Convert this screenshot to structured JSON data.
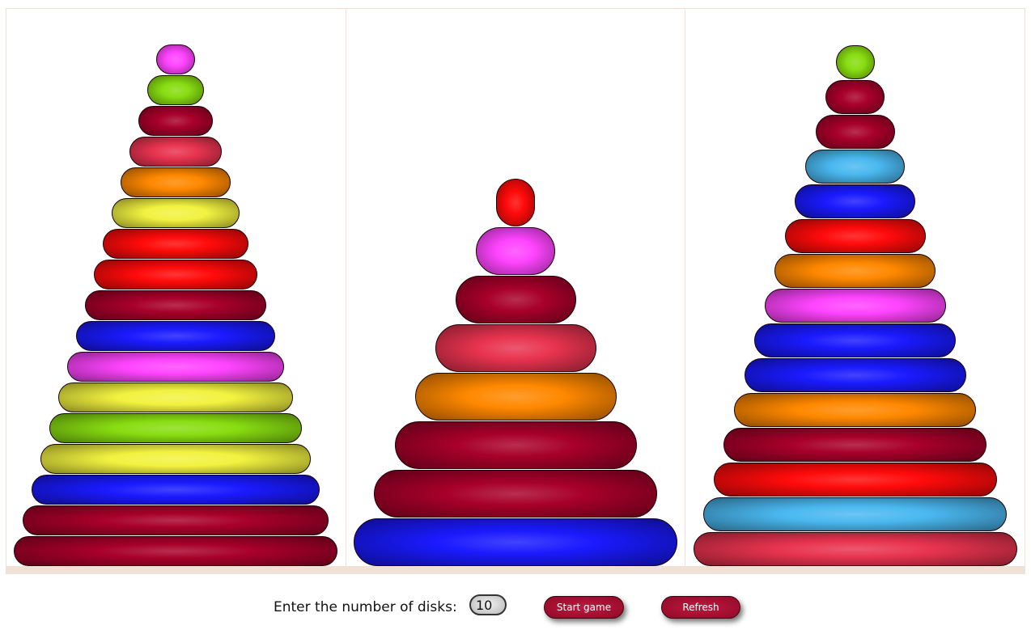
{
  "colors": {
    "magenta": "#ff44ff",
    "green": "#88dd11",
    "maroon": "#a8002a",
    "crimson": "#e8334f",
    "orange": "#ff8800",
    "yellow": "#f2f240",
    "red": "#ff0a0a",
    "blue": "#1a1aff",
    "cyan": "#4ab8f0"
  },
  "towers": [
    {
      "name": "left",
      "disks": [
        "magenta",
        "green",
        "maroon",
        "crimson",
        "orange",
        "yellow",
        "red",
        "red",
        "maroon",
        "blue",
        "magenta",
        "yellow",
        "green",
        "yellow",
        "blue",
        "maroon",
        "maroon"
      ]
    },
    {
      "name": "middle",
      "disks": [
        "red",
        "magenta",
        "maroon",
        "crimson",
        "orange",
        "maroon",
        "maroon",
        "blue"
      ]
    },
    {
      "name": "right",
      "disks": [
        "green",
        "maroon",
        "maroon",
        "cyan",
        "blue",
        "red",
        "orange",
        "magenta",
        "blue",
        "blue",
        "orange",
        "maroon",
        "red",
        "cyan",
        "crimson"
      ]
    }
  ],
  "controls": {
    "label": "Enter the number of disks:",
    "disks_value": "10",
    "start_label": "Start game",
    "refresh_label": "Refresh"
  }
}
